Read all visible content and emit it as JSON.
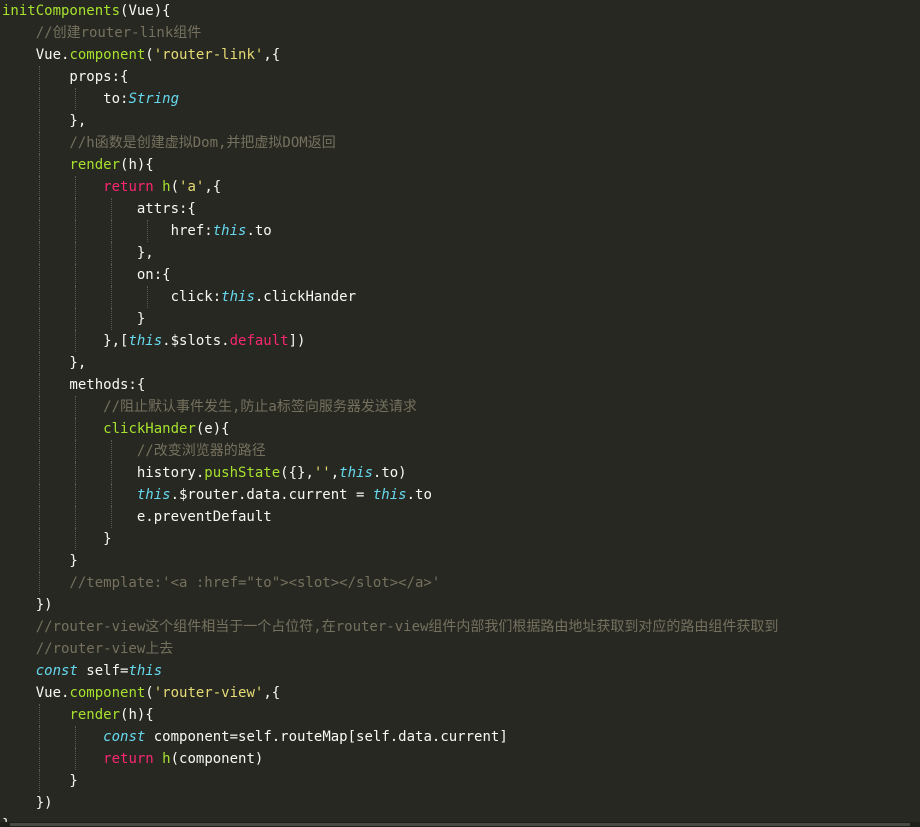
{
  "editor": {
    "theme_colors": {
      "background": "#272822",
      "text": "#f8f8f2",
      "function": "#a6e22e",
      "string": "#e6db74",
      "keyword": "#f92672",
      "this": "#66d9ef",
      "comment": "#75715e"
    },
    "lines": [
      {
        "tokens": [
          {
            "t": "initComponents",
            "c": "fn"
          },
          {
            "t": "(Vue){",
            "c": "plain"
          }
        ]
      },
      {
        "tokens": [
          {
            "t": "    //创建router-link组件",
            "c": "cmt"
          }
        ]
      },
      {
        "tokens": [
          {
            "t": "    Vue.",
            "c": "plain"
          },
          {
            "t": "component",
            "c": "fn"
          },
          {
            "t": "(",
            "c": "plain"
          },
          {
            "t": "'router-link'",
            "c": "str"
          },
          {
            "t": ",{",
            "c": "plain"
          }
        ]
      },
      {
        "tokens": [
          {
            "t": "        props:{",
            "c": "plain"
          }
        ]
      },
      {
        "tokens": [
          {
            "t": "            to:",
            "c": "plain"
          },
          {
            "t": "String",
            "c": "type"
          }
        ]
      },
      {
        "tokens": [
          {
            "t": "        },",
            "c": "plain"
          }
        ]
      },
      {
        "tokens": [
          {
            "t": "        //h函数是创建虚拟Dom,并把虚拟DOM返回",
            "c": "cmt"
          }
        ]
      },
      {
        "tokens": [
          {
            "t": "        ",
            "c": "plain"
          },
          {
            "t": "render",
            "c": "fn"
          },
          {
            "t": "(h){",
            "c": "plain"
          }
        ]
      },
      {
        "tokens": [
          {
            "t": "            ",
            "c": "plain"
          },
          {
            "t": "return",
            "c": "kw"
          },
          {
            "t": " ",
            "c": "plain"
          },
          {
            "t": "h",
            "c": "fn"
          },
          {
            "t": "(",
            "c": "plain"
          },
          {
            "t": "'a'",
            "c": "str"
          },
          {
            "t": ",{",
            "c": "plain"
          }
        ]
      },
      {
        "tokens": [
          {
            "t": "                attrs:{",
            "c": "plain"
          }
        ]
      },
      {
        "tokens": [
          {
            "t": "                    href:",
            "c": "plain"
          },
          {
            "t": "this",
            "c": "this"
          },
          {
            "t": ".to",
            "c": "plain"
          }
        ]
      },
      {
        "tokens": [
          {
            "t": "                },",
            "c": "plain"
          }
        ]
      },
      {
        "tokens": [
          {
            "t": "                on:{",
            "c": "plain"
          }
        ]
      },
      {
        "tokens": [
          {
            "t": "                    click:",
            "c": "plain"
          },
          {
            "t": "this",
            "c": "this"
          },
          {
            "t": ".clickHander",
            "c": "plain"
          }
        ]
      },
      {
        "tokens": [
          {
            "t": "                }",
            "c": "plain"
          }
        ]
      },
      {
        "tokens": [
          {
            "t": "            },[",
            "c": "plain"
          },
          {
            "t": "this",
            "c": "this"
          },
          {
            "t": ".$slots.",
            "c": "plain"
          },
          {
            "t": "default",
            "c": "def"
          },
          {
            "t": "])",
            "c": "plain"
          }
        ]
      },
      {
        "tokens": [
          {
            "t": "        },",
            "c": "plain"
          }
        ]
      },
      {
        "tokens": [
          {
            "t": "        methods:{",
            "c": "plain"
          }
        ]
      },
      {
        "tokens": [
          {
            "t": "            //阻止默认事件发生,防止a标签向服务器发送请求",
            "c": "cmt"
          }
        ]
      },
      {
        "tokens": [
          {
            "t": "            ",
            "c": "plain"
          },
          {
            "t": "clickHander",
            "c": "fn"
          },
          {
            "t": "(e){",
            "c": "plain"
          }
        ]
      },
      {
        "tokens": [
          {
            "t": "                //改变浏览器的路径",
            "c": "cmt"
          }
        ]
      },
      {
        "tokens": [
          {
            "t": "                history.",
            "c": "plain"
          },
          {
            "t": "pushState",
            "c": "fn"
          },
          {
            "t": "({},",
            "c": "plain"
          },
          {
            "t": "''",
            "c": "str"
          },
          {
            "t": ",",
            "c": "plain"
          },
          {
            "t": "this",
            "c": "this"
          },
          {
            "t": ".to)",
            "c": "plain"
          }
        ]
      },
      {
        "tokens": [
          {
            "t": "                ",
            "c": "plain"
          },
          {
            "t": "this",
            "c": "this"
          },
          {
            "t": ".$router.data.current = ",
            "c": "plain"
          },
          {
            "t": "this",
            "c": "this"
          },
          {
            "t": ".to",
            "c": "plain"
          }
        ]
      },
      {
        "tokens": [
          {
            "t": "                e.preventDefault",
            "c": "plain"
          }
        ]
      },
      {
        "tokens": [
          {
            "t": "            }",
            "c": "plain"
          }
        ]
      },
      {
        "tokens": [
          {
            "t": "        }",
            "c": "plain"
          }
        ]
      },
      {
        "tokens": [
          {
            "t": "        //template:'<a :href=\"to\"><slot></slot></a>'",
            "c": "cmt"
          }
        ]
      },
      {
        "tokens": [
          {
            "t": "    })",
            "c": "plain"
          }
        ]
      },
      {
        "tokens": [
          {
            "t": "    //router-view这个组件相当于一个占位符,在router-view组件内部我们根据路由地址获取到对应的路由组件获取到",
            "c": "cmt"
          }
        ]
      },
      {
        "tokens": [
          {
            "t": "    //router-view上去",
            "c": "cmt"
          }
        ]
      },
      {
        "tokens": [
          {
            "t": "    ",
            "c": "plain"
          },
          {
            "t": "const",
            "c": "this"
          },
          {
            "t": " self=",
            "c": "plain"
          },
          {
            "t": "this",
            "c": "this"
          }
        ]
      },
      {
        "tokens": [
          {
            "t": "    Vue.",
            "c": "plain"
          },
          {
            "t": "component",
            "c": "fn"
          },
          {
            "t": "(",
            "c": "plain"
          },
          {
            "t": "'router-view'",
            "c": "str"
          },
          {
            "t": ",{",
            "c": "plain"
          }
        ]
      },
      {
        "tokens": [
          {
            "t": "        ",
            "c": "plain"
          },
          {
            "t": "render",
            "c": "fn"
          },
          {
            "t": "(h){",
            "c": "plain"
          }
        ]
      },
      {
        "tokens": [
          {
            "t": "            ",
            "c": "plain"
          },
          {
            "t": "const",
            "c": "this"
          },
          {
            "t": " component=self.routeMap[self.data.current]",
            "c": "plain"
          }
        ]
      },
      {
        "tokens": [
          {
            "t": "            ",
            "c": "plain"
          },
          {
            "t": "return",
            "c": "kw"
          },
          {
            "t": " ",
            "c": "plain"
          },
          {
            "t": "h",
            "c": "fn"
          },
          {
            "t": "(component)",
            "c": "plain"
          }
        ]
      },
      {
        "tokens": [
          {
            "t": "        }",
            "c": "plain"
          }
        ]
      },
      {
        "tokens": [
          {
            "t": "    })",
            "c": "plain"
          }
        ]
      },
      {
        "tokens": [
          {
            "t": "}",
            "c": "plain"
          }
        ]
      }
    ]
  }
}
